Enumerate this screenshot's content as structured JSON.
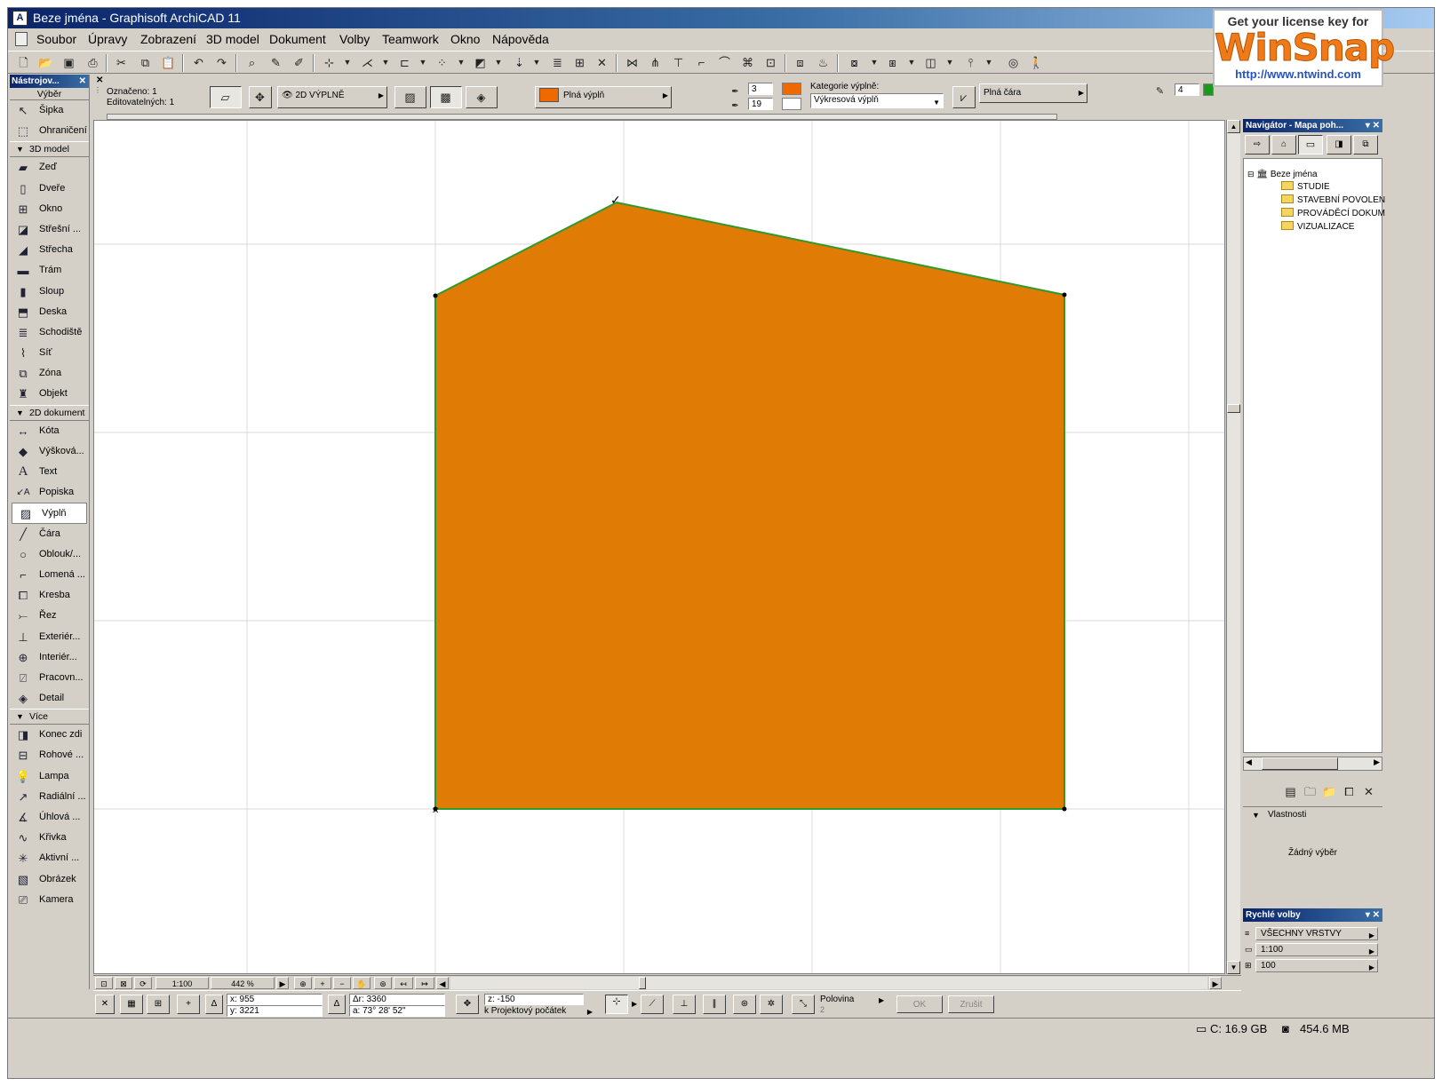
{
  "window": {
    "title": "Beze jména - Graphisoft ArchiCAD 11"
  },
  "menu": [
    "Soubor",
    "Úpravy",
    "Zobrazení",
    "3D model",
    "Dokument",
    "Volby",
    "Teamwork",
    "Okno",
    "Nápověda"
  ],
  "toolbox": {
    "title": "Nástrojov...",
    "top": [
      {
        "label": "Výběr",
        "icon": "selection-header-icon"
      },
      {
        "label": "Šipka",
        "icon": "arrow-icon"
      },
      {
        "label": "Ohraničení",
        "icon": "marquee-icon"
      }
    ],
    "sections": [
      {
        "label": "3D model",
        "items": [
          {
            "label": "Zeď",
            "icon": "wall-icon"
          },
          {
            "label": "Dveře",
            "icon": "door-icon"
          },
          {
            "label": "Okno",
            "icon": "window-icon"
          },
          {
            "label": "Střešní ...",
            "icon": "roof-window-icon"
          },
          {
            "label": "Střecha",
            "icon": "roof-icon"
          },
          {
            "label": "Trám",
            "icon": "beam-icon"
          },
          {
            "label": "Sloup",
            "icon": "column-icon"
          },
          {
            "label": "Deska",
            "icon": "slab-icon"
          },
          {
            "label": "Schodiště",
            "icon": "stair-icon"
          },
          {
            "label": "Síť",
            "icon": "mesh-icon"
          },
          {
            "label": "Zóna",
            "icon": "zone-icon"
          },
          {
            "label": "Objekt",
            "icon": "object-icon"
          }
        ]
      },
      {
        "label": "2D dokument",
        "items": [
          {
            "label": "Kóta",
            "icon": "dimension-icon"
          },
          {
            "label": "Výšková...",
            "icon": "level-dimension-icon"
          },
          {
            "label": "Text",
            "icon": "text-icon"
          },
          {
            "label": "Popiska",
            "icon": "label-icon"
          },
          {
            "label": "Výplň",
            "icon": "fill-icon",
            "selected": true
          },
          {
            "label": "Čára",
            "icon": "line-icon"
          },
          {
            "label": "Oblouk/...",
            "icon": "arc-icon"
          },
          {
            "label": "Lomená ...",
            "icon": "polyline-icon"
          },
          {
            "label": "Kresba",
            "icon": "drawing-icon"
          },
          {
            "label": "Řez",
            "icon": "section-icon"
          },
          {
            "label": "Exteriér...",
            "icon": "elevation-icon"
          },
          {
            "label": "Interiér...",
            "icon": "interior-elevation-icon"
          },
          {
            "label": "Pracovn...",
            "icon": "worksheet-icon"
          },
          {
            "label": "Detail",
            "icon": "detail-icon"
          }
        ]
      },
      {
        "label": "Více",
        "items": [
          {
            "label": "Konec zdi",
            "icon": "wall-end-icon"
          },
          {
            "label": "Rohové ...",
            "icon": "corner-window-icon"
          },
          {
            "label": "Lampa",
            "icon": "lamp-icon"
          },
          {
            "label": "Radiální ...",
            "icon": "radial-dimension-icon"
          },
          {
            "label": "Úhlová ...",
            "icon": "angle-dimension-icon"
          },
          {
            "label": "Křivka",
            "icon": "spline-icon"
          },
          {
            "label": "Aktivní ...",
            "icon": "hotspot-icon"
          },
          {
            "label": "Obrázek",
            "icon": "picture-icon"
          },
          {
            "label": "Kamera",
            "icon": "camera-icon"
          }
        ]
      }
    ]
  },
  "infobox": {
    "selected": "Označeno: 1",
    "editable": "Editovatelných: 1",
    "layer_button": "2D VÝPLNĚ",
    "fill_name": "Plná výplň",
    "pen1": "3",
    "pen2": "19",
    "category_label": "Kategorie výplně:",
    "category_value": "Výkresová výplň",
    "line_type": "Plná čára",
    "pen3": "4",
    "fill_color": "#ee6a00"
  },
  "canvas": {
    "fill_color": "#e07b05",
    "outline_color": "#2e9a2e"
  },
  "hbar": {
    "scale": "1:100",
    "zoom": "442 %"
  },
  "coords": {
    "x": "x: 955",
    "y": "y: 3221",
    "dr": "Δr: 3360",
    "a": "a: 73° 28' 52\"",
    "z": "z: -150",
    "ref": "k Projektový počátek",
    "half": "Polovina",
    "half_num": "2",
    "ok": "OK",
    "cancel": "Zrušit"
  },
  "status": {
    "disk": "C: 16.9 GB",
    "mem": "454.6 MB"
  },
  "navigator": {
    "title": "Navigátor - Mapa poh...",
    "root": "Beze jména",
    "folders": [
      "STUDIE",
      "STAVEBNÍ POVOLEN",
      "PROVÁDĚCÍ DOKUM",
      "VIZUALIZACE"
    ],
    "props_label": "Vlastnosti",
    "no_selection": "Žádný výběr"
  },
  "quick": {
    "title": "Rychlé volby",
    "layers": "VŠECHNY VRSTVY",
    "scale": "1:100",
    "zoom": "100"
  },
  "watermark": {
    "line1": "Get your license key for",
    "brand": "WinSnap",
    "url": "http://www.ntwind.com"
  }
}
